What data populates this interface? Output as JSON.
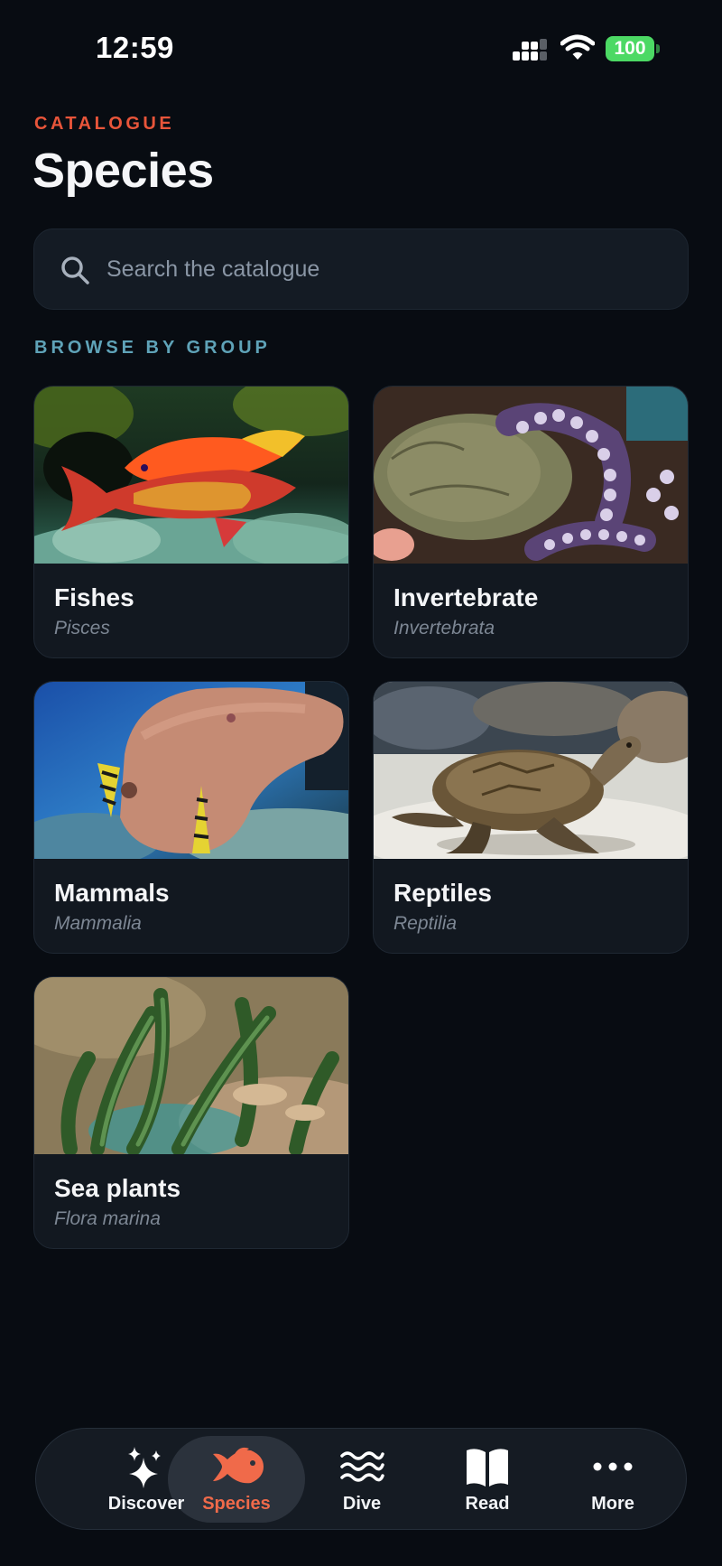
{
  "status_bar": {
    "time": "12:59",
    "battery": "100",
    "battery_color": "#4cd964"
  },
  "header": {
    "eyebrow": "CATALOGUE",
    "title": "Species"
  },
  "search": {
    "placeholder": "Search the catalogue",
    "value": ""
  },
  "section_label": "BROWSE BY GROUP",
  "groups": [
    {
      "name": "Fishes",
      "latin": "Pisces",
      "image": "red-sea-anthias-photo"
    },
    {
      "name": "Invertebrate",
      "latin": "Invertebrata",
      "image": "octopus-photo"
    },
    {
      "name": "Mammals",
      "latin": "Mammalia",
      "image": "dugong-photo"
    },
    {
      "name": "Reptiles",
      "latin": "Reptilia",
      "image": "sea-turtle-photo"
    },
    {
      "name": "Sea plants",
      "latin": "Flora marina",
      "image": "seagrass-photo"
    }
  ],
  "tabbar": {
    "active": "Species",
    "accent_color": "#f06a4a",
    "tabs": [
      {
        "label": "Discover",
        "icon": "sparkles-icon"
      },
      {
        "label": "Species",
        "icon": "fish-icon"
      },
      {
        "label": "Dive",
        "icon": "waves-icon"
      },
      {
        "label": "Read",
        "icon": "book-icon"
      },
      {
        "label": "More",
        "icon": "ellipsis-icon"
      }
    ]
  }
}
